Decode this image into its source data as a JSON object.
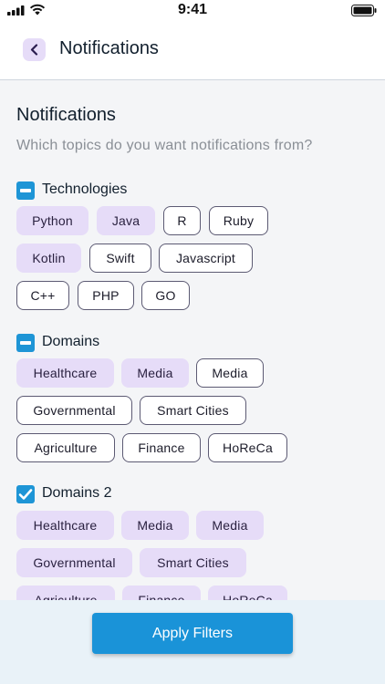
{
  "status_bar": {
    "time": "9:41"
  },
  "header": {
    "title": "Notifications"
  },
  "section": {
    "title": "Notifications",
    "subtitle": "Which topics do you want notifications from?"
  },
  "groups": [
    {
      "label": "Technologies",
      "state": "indeterminate",
      "chips": [
        {
          "label": "Python",
          "selected": true
        },
        {
          "label": "Java",
          "selected": true
        },
        {
          "label": "R",
          "selected": false
        },
        {
          "label": "Ruby",
          "selected": false
        },
        {
          "label": "Kotlin",
          "selected": true
        },
        {
          "label": "Swift",
          "selected": false
        },
        {
          "label": "Javascript",
          "selected": false
        },
        {
          "label": "C++",
          "selected": false
        },
        {
          "label": "PHP",
          "selected": false
        },
        {
          "label": "GO",
          "selected": false
        }
      ]
    },
    {
      "label": "Domains",
      "state": "indeterminate",
      "chips": [
        {
          "label": "Healthcare",
          "selected": true
        },
        {
          "label": "Media",
          "selected": true
        },
        {
          "label": "Media",
          "selected": false
        },
        {
          "label": "Governmental",
          "selected": false
        },
        {
          "label": "Smart Cities",
          "selected": false
        },
        {
          "label": "Agriculture",
          "selected": false
        },
        {
          "label": "Finance",
          "selected": false
        },
        {
          "label": "HoReCa",
          "selected": false
        }
      ]
    },
    {
      "label": "Domains 2",
      "state": "checked",
      "chips": [
        {
          "label": "Healthcare",
          "selected": true
        },
        {
          "label": "Media",
          "selected": true
        },
        {
          "label": "Media",
          "selected": true
        },
        {
          "label": "Governmental",
          "selected": true
        },
        {
          "label": "Smart Cities",
          "selected": true
        },
        {
          "label": "Agriculture",
          "selected": true
        },
        {
          "label": "Finance",
          "selected": true
        },
        {
          "label": "HoReCa",
          "selected": true
        }
      ]
    }
  ],
  "footer": {
    "apply_label": "Apply Filters"
  },
  "colors": {
    "accent": "#1a93d8",
    "chip_selected": "#e6dcf8",
    "chip_border": "#5c5a73"
  }
}
